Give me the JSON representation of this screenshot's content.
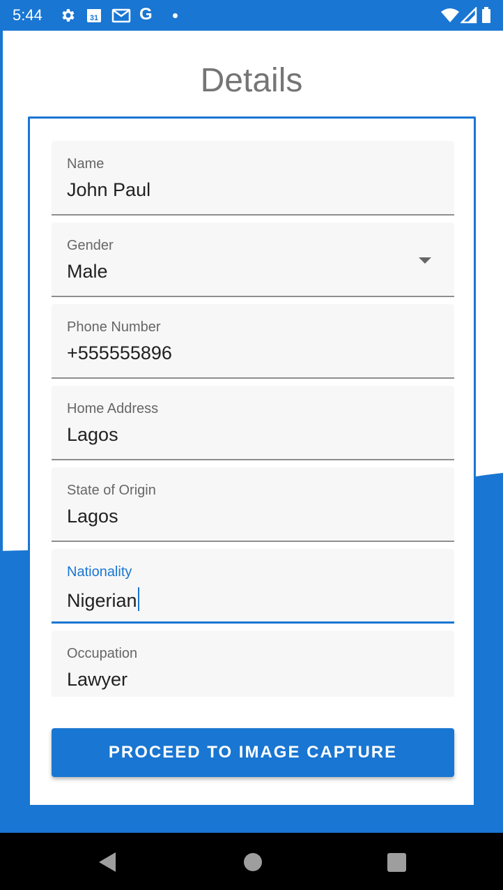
{
  "status_bar": {
    "time": "5:44",
    "calendar_day": "31",
    "google_letter": "G",
    "icons": [
      "gear-icon",
      "calendar-icon",
      "gmail-icon",
      "google-icon",
      "notification-dot-icon",
      "wifi-icon",
      "signal-icon",
      "battery-icon"
    ]
  },
  "page": {
    "title": "Details"
  },
  "form": {
    "fields": [
      {
        "label": "Name",
        "value": "John Paul"
      },
      {
        "label": "Gender",
        "value": "Male"
      },
      {
        "label": "Phone Number",
        "value": "+555555896"
      },
      {
        "label": "Home Address",
        "value": "Lagos"
      },
      {
        "label": "State of Origin",
        "value": "Lagos"
      },
      {
        "label": "Nationality",
        "value": "Nigerian"
      },
      {
        "label": "Occupation",
        "value": "Lawyer"
      }
    ],
    "submit_label": "PROCEED TO IMAGE CAPTURE"
  },
  "colors": {
    "primary": "#1976d2",
    "field_bg": "#f8f7f8",
    "title": "#757575"
  },
  "nav_bar": {
    "icons": [
      "back-icon",
      "home-icon",
      "recents-icon"
    ]
  }
}
